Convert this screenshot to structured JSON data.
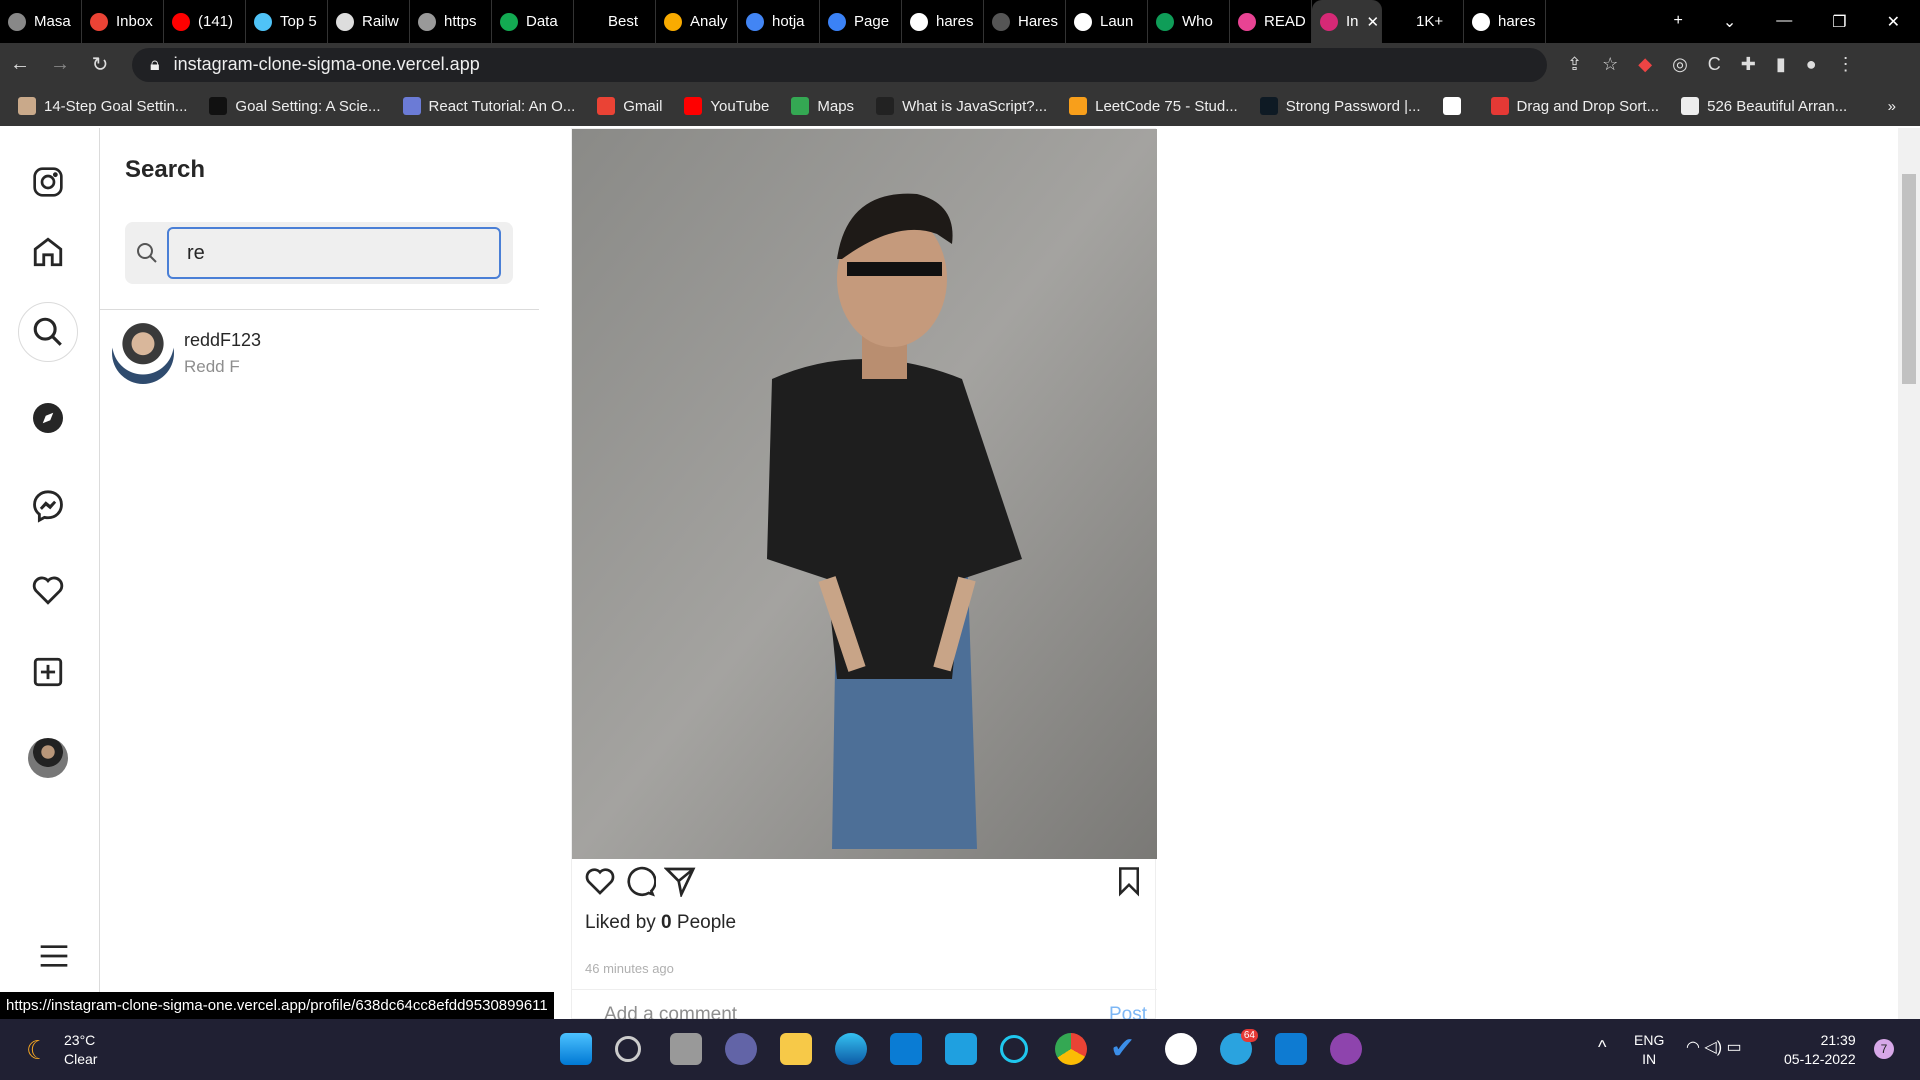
{
  "browser": {
    "tabs": [
      {
        "label": "Masa",
        "color": "#888"
      },
      {
        "label": "Inbox",
        "color": "#ea4335"
      },
      {
        "label": "(141)",
        "color": "#ff0000"
      },
      {
        "label": "Top 5",
        "color": "#4fc3f7"
      },
      {
        "label": "Railw",
        "color": "#ddd"
      },
      {
        "label": "https",
        "color": "#999"
      },
      {
        "label": "Data",
        "color": "#13aa52"
      },
      {
        "label": "Best",
        "color": "#000"
      },
      {
        "label": "Analy",
        "color": "#f9ab00"
      },
      {
        "label": "hotja",
        "color": "#4285f4"
      },
      {
        "label": "Page",
        "color": "#3b82f6"
      },
      {
        "label": "hares",
        "color": "#fff"
      },
      {
        "label": "Hares",
        "color": "#555"
      },
      {
        "label": "Laun",
        "color": "#fff"
      },
      {
        "label": "Who",
        "color": "#0f9d58"
      },
      {
        "label": "READ",
        "color": "#e84393"
      },
      {
        "label": "In",
        "color": "#d62976",
        "active": true
      },
      {
        "label": "1K+",
        "color": "#000"
      },
      {
        "label": "hares",
        "color": "#fff"
      }
    ],
    "url": "instagram-clone-sigma-one.vercel.app",
    "bookmarks": [
      {
        "label": "14-Step Goal Settin...",
        "color": "#c9a98a"
      },
      {
        "label": "Goal Setting: A Scie...",
        "color": "#111"
      },
      {
        "label": "React Tutorial: An O...",
        "color": "#6b7bd6"
      },
      {
        "label": "Gmail",
        "color": "#ea4335"
      },
      {
        "label": "YouTube",
        "color": "#ff0000"
      },
      {
        "label": "Maps",
        "color": "#34a853"
      },
      {
        "label": "What is JavaScript?...",
        "color": "#222"
      },
      {
        "label": "LeetCode 75 - Stud...",
        "color": "#f89f1b"
      },
      {
        "label": "Strong Password |...",
        "color": "#0e1a24"
      },
      {
        "label": "",
        "color": "#fff"
      },
      {
        "label": "Drag and Drop Sort...",
        "color": "#e53935"
      },
      {
        "label": "526 Beautiful Arran...",
        "color": "#eee"
      }
    ],
    "status_url": "https://instagram-clone-sigma-one.vercel.app/profile/638dc64cc8efdd9530899611"
  },
  "search": {
    "title": "Search",
    "query": "re",
    "results": [
      {
        "username": "reddF123",
        "name": "Redd F"
      }
    ]
  },
  "post": {
    "liked_prefix": "Liked by ",
    "likes": "0",
    "liked_suffix": " People",
    "time": "46 minutes ago",
    "comment_placeholder": "Add a comment",
    "post_label": "Post"
  },
  "taskbar": {
    "temp": "23°C",
    "weather": "Clear",
    "lang": "ENG",
    "region": "IN",
    "time": "21:39",
    "date": "05-12-2022",
    "notif_count": "7",
    "telegram_badge": "64"
  }
}
